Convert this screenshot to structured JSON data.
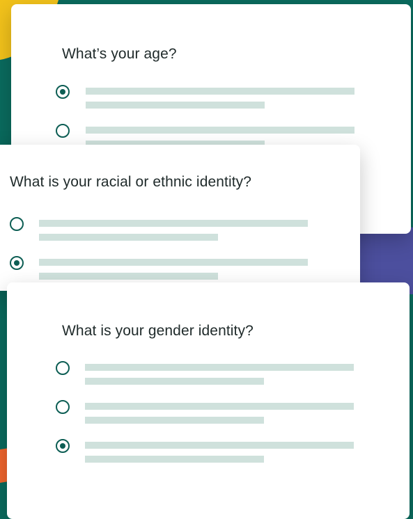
{
  "colors": {
    "background": "#0a6b5e",
    "yellow_shape": "#f2c21b",
    "purple_shape": "#4c4f9e",
    "orange_shape": "#f0652d",
    "radio": "#0d5e54",
    "placeholder_bar": "#cfe1dc"
  },
  "icons": {
    "selected": "radio-checked-icon",
    "unselected": "radio-unchecked-icon"
  },
  "cards": [
    {
      "question": "What’s your age?",
      "options": [
        {
          "checked": true
        },
        {
          "checked": false
        }
      ]
    },
    {
      "question": "What is your racial or ethnic identity?",
      "options": [
        {
          "checked": false
        },
        {
          "checked": true
        }
      ]
    },
    {
      "question": "What is your gender identity?",
      "options": [
        {
          "checked": false
        },
        {
          "checked": false
        },
        {
          "checked": true
        }
      ]
    }
  ]
}
